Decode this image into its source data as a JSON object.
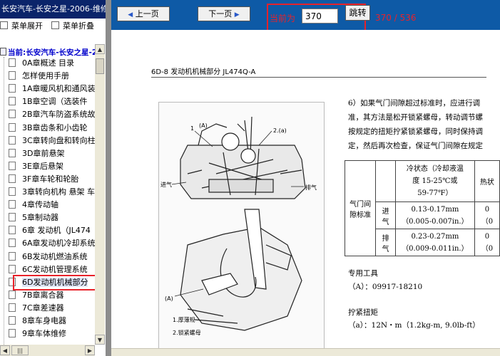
{
  "left_title": "长安汽车-长安之星-2006-维修",
  "toolbar": {
    "expand_label": "菜单展开",
    "collapse_label": "菜单折叠"
  },
  "tree": {
    "root_label": "当前:长安汽车-长安之星-2",
    "items": [
      "0A章概述 目录",
      "怎样使用手册",
      "1A章暖风机和通风装",
      "1B章空调（选装件",
      "2B章汽车防盗系统故",
      "3B章齿条和小齿轮",
      "3C章转向盘和转向柱",
      "3D章前悬架",
      "3E章后悬架",
      "3F章车轮和轮胎",
      "3章转向机构 悬架 车",
      "4章传动轴",
      "5章制动器",
      "6章 发动机（JL474",
      "6A章发动机冷却系统",
      "6B发动机燃油系统",
      "6C发动机管理系统",
      "6D发动机机械部分",
      "7B章离合器",
      "7C章差速器",
      "8章车身电器",
      "9章车体维修"
    ],
    "selected_index": 17
  },
  "nav": {
    "prev_label": "上一页",
    "next_label": "下一页",
    "page_label": "当前为",
    "page_value": "370",
    "jump_label": "跳转",
    "page_count": "370 / 536"
  },
  "document": {
    "header": "6D-8    发动机机械部分 JL474Q-A",
    "para_lines": [
      "6）如果气门间隙超过标准时，应进行调",
      "准，其方法是松开锁紧螺母，转动调节螺",
      "按规定的扭矩拧紧锁紧螺母，同时保持调",
      "定，然后再次检查，保证气门间隙在规定"
    ],
    "table": {
      "row_header": "气门间隙标准",
      "cold_header": [
        "冷状态（冷却液温",
        "度 15-25℃或",
        "59-77℉）"
      ],
      "hot_header": "热状",
      "intake_label": "进气",
      "intake_value": [
        "0.13-0.17mm",
        "（0.005-0.007in.）"
      ],
      "exhaust_label": "排气",
      "exhaust_value": [
        "0.23-0.27mm",
        "（0.009-0.011in.）"
      ],
      "hot_intake": [
        "0",
        "（0"
      ],
      "hot_exhaust": [
        "0",
        "（0"
      ]
    },
    "tool_title": "专用工具",
    "tool_value": "（A）：09917-18210",
    "torque_title": "拧紧扭矩",
    "torque_value": "（a）：12N・m（1.2kg-m, 9.0lb-ft）",
    "figure": {
      "label_a_top": "(A)",
      "label_1": "1",
      "label_2a": "2.(a)",
      "label_intake": "进气",
      "label_exhaust": "排气",
      "label_a_bottom": "(A)",
      "caption_1": "1.厚薄规",
      "caption_2": "2.锁紧螺母"
    }
  }
}
